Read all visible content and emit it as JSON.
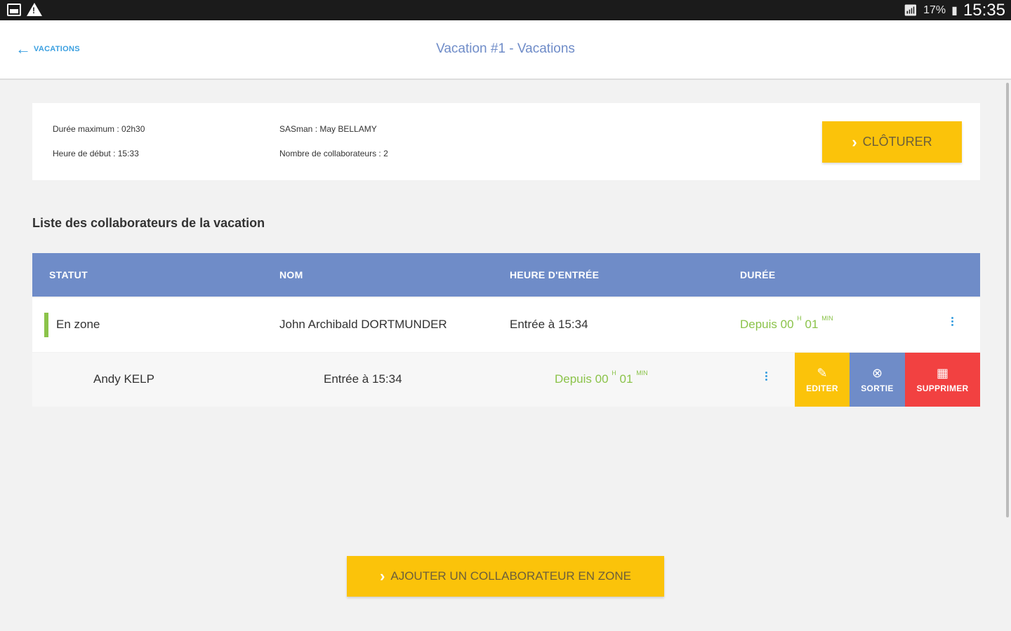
{
  "status_bar": {
    "battery": "17%",
    "time": "15:35",
    "icons": [
      "image-icon",
      "warning-icon",
      "wifi-icon",
      "battery-icon"
    ]
  },
  "appbar": {
    "back_label": "VACATIONS",
    "title": "Vacation #1 - Vacations"
  },
  "info": {
    "duree_max": "Durée maximum : 02h30",
    "heure_debut": "Heure de début : 15:33",
    "sasman": "SASman : May BELLAMY",
    "nb_collab": "Nombre de collaborateurs : 2",
    "cloturer_label": "CLÔTURER"
  },
  "section_title": "Liste des collaborateurs de la vacation",
  "table": {
    "headers": [
      "STATUT",
      "NOM",
      "HEURE D'ENTRÉE",
      "DURÉE"
    ],
    "rows": [
      {
        "statut": "En zone",
        "nom": "John Archibald DORTMUNDER",
        "entree": "Entrée à 15:34",
        "duree_prefix": "Depuis 00",
        "duree_h": "H",
        "duree_min_val": "01",
        "duree_min": "MIN"
      },
      {
        "statut": "",
        "nom": "Andy KELP",
        "entree": "Entrée à 15:34",
        "duree_prefix": "Depuis 00",
        "duree_h": "H",
        "duree_min_val": "01",
        "duree_min": "MIN"
      }
    ],
    "actions": {
      "edit": "EDITER",
      "sortie": "SORTIE",
      "delete": "SUPPRIMER"
    }
  },
  "add_button_label": "AJOUTER UN COLLABORATEUR EN ZONE",
  "colors": {
    "accent_blue": "#6f8cc8",
    "link_blue": "#3a9fe0",
    "yellow": "#fbc30a",
    "red": "#f24141",
    "green": "#8bc34a"
  }
}
